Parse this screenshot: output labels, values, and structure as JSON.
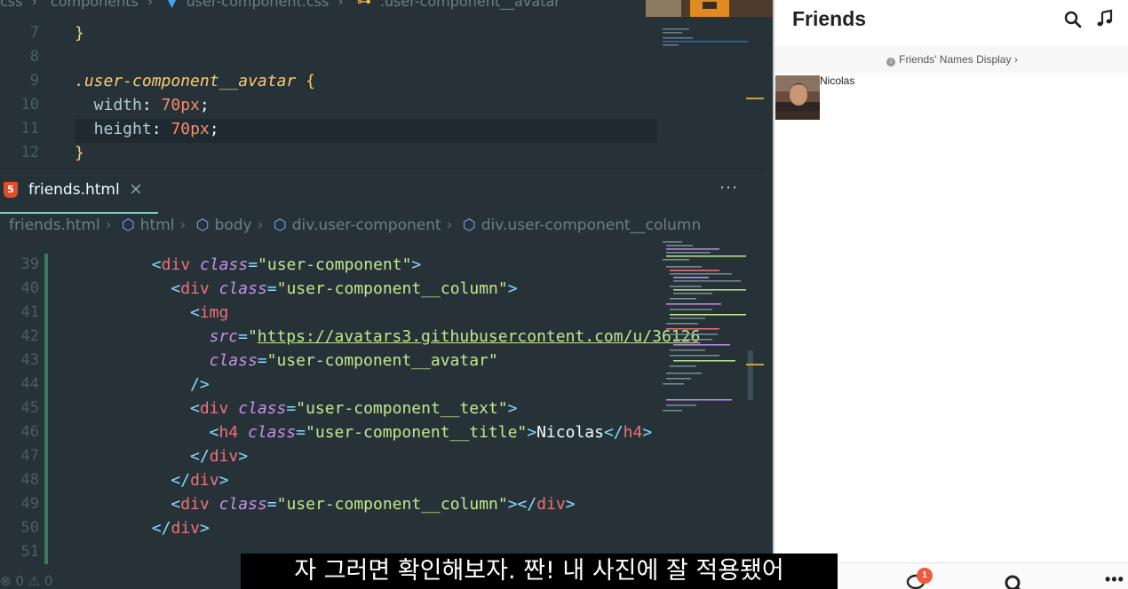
{
  "editor": {
    "top_breadcrumb": [
      "css",
      "components",
      "user-component.css",
      ".user-component__avatar"
    ],
    "css_lines": [
      {
        "num": "7",
        "parts": [
          {
            "c": "t-brace",
            "t": "}"
          }
        ]
      },
      {
        "num": "8",
        "parts": []
      },
      {
        "num": "9",
        "parts": [
          {
            "c": "t-sel",
            "t": ".user-component__avatar"
          },
          {
            "c": "t-plain",
            "t": " "
          },
          {
            "c": "t-brace",
            "t": "{"
          }
        ]
      },
      {
        "num": "10",
        "parts": [
          {
            "c": "t-prop",
            "t": "  width"
          },
          {
            "c": "t-plain",
            "t": ": "
          },
          {
            "c": "t-num",
            "t": "70px"
          },
          {
            "c": "t-plain",
            "t": ";"
          }
        ]
      },
      {
        "num": "11",
        "parts": [
          {
            "c": "t-prop",
            "t": "  height"
          },
          {
            "c": "t-plain",
            "t": ": "
          },
          {
            "c": "t-num",
            "t": "70px"
          },
          {
            "c": "t-plain",
            "t": ";"
          }
        ]
      },
      {
        "num": "12",
        "parts": [
          {
            "c": "t-brace",
            "t": "}"
          }
        ]
      }
    ],
    "tab": {
      "title": "friends.html",
      "close": "×",
      "more": "···",
      "icon_text": "5"
    },
    "breadcrumb": [
      "friends.html",
      "html",
      "body",
      "div.user-component",
      "div.user-component__column"
    ],
    "html_lines": [
      {
        "num": "39",
        "indent": 6,
        "parts": [
          {
            "c": "t-punc",
            "t": "<"
          },
          {
            "c": "t-tag",
            "t": "div"
          },
          {
            "c": "t-plain",
            "t": " "
          },
          {
            "c": "t-attr",
            "t": "class"
          },
          {
            "c": "t-punc",
            "t": "="
          },
          {
            "c": "t-str",
            "t": "\"user-component\""
          },
          {
            "c": "t-punc",
            "t": ">"
          }
        ]
      },
      {
        "num": "40",
        "indent": 8,
        "parts": [
          {
            "c": "t-punc",
            "t": "<"
          },
          {
            "c": "t-tag",
            "t": "div"
          },
          {
            "c": "t-plain",
            "t": " "
          },
          {
            "c": "t-attr",
            "t": "class"
          },
          {
            "c": "t-punc",
            "t": "="
          },
          {
            "c": "t-str",
            "t": "\"user-component__column\""
          },
          {
            "c": "t-punc",
            "t": ">"
          }
        ]
      },
      {
        "num": "41",
        "indent": 10,
        "parts": [
          {
            "c": "t-punc",
            "t": "<"
          },
          {
            "c": "t-tag",
            "t": "img"
          }
        ]
      },
      {
        "num": "42",
        "indent": 12,
        "parts": [
          {
            "c": "t-attr",
            "t": "src"
          },
          {
            "c": "t-punc",
            "t": "="
          },
          {
            "c": "t-str",
            "t": "\""
          },
          {
            "c": "t-link",
            "t": "https://avatars3.githubusercontent.com/u/36126"
          }
        ]
      },
      {
        "num": "43",
        "indent": 12,
        "parts": [
          {
            "c": "t-attr",
            "t": "class"
          },
          {
            "c": "t-punc",
            "t": "="
          },
          {
            "c": "t-str",
            "t": "\"user-component__avatar\""
          }
        ]
      },
      {
        "num": "44",
        "indent": 10,
        "parts": [
          {
            "c": "t-punc",
            "t": "/>"
          }
        ]
      },
      {
        "num": "45",
        "indent": 10,
        "parts": [
          {
            "c": "t-punc",
            "t": "<"
          },
          {
            "c": "t-tag",
            "t": "div"
          },
          {
            "c": "t-plain",
            "t": " "
          },
          {
            "c": "t-attr",
            "t": "class"
          },
          {
            "c": "t-punc",
            "t": "="
          },
          {
            "c": "t-str",
            "t": "\"user-component__text\""
          },
          {
            "c": "t-punc",
            "t": ">"
          }
        ]
      },
      {
        "num": "46",
        "indent": 12,
        "parts": [
          {
            "c": "t-punc",
            "t": "<"
          },
          {
            "c": "t-tag",
            "t": "h4"
          },
          {
            "c": "t-plain",
            "t": " "
          },
          {
            "c": "t-attr",
            "t": "class"
          },
          {
            "c": "t-punc",
            "t": "="
          },
          {
            "c": "t-str",
            "t": "\"user-component__title\""
          },
          {
            "c": "t-punc",
            "t": ">"
          },
          {
            "c": "t-plain",
            "t": "Nicolas"
          },
          {
            "c": "t-punc",
            "t": "</"
          },
          {
            "c": "t-tag",
            "t": "h4"
          },
          {
            "c": "t-punc",
            "t": ">"
          }
        ]
      },
      {
        "num": "47",
        "indent": 10,
        "parts": [
          {
            "c": "t-punc",
            "t": "</"
          },
          {
            "c": "t-tag",
            "t": "div"
          },
          {
            "c": "t-punc",
            "t": ">"
          }
        ]
      },
      {
        "num": "48",
        "indent": 8,
        "parts": [
          {
            "c": "t-punc",
            "t": "</"
          },
          {
            "c": "t-tag",
            "t": "div"
          },
          {
            "c": "t-punc",
            "t": ">"
          }
        ]
      },
      {
        "num": "49",
        "indent": 8,
        "parts": [
          {
            "c": "t-punc",
            "t": "<"
          },
          {
            "c": "t-tag",
            "t": "div"
          },
          {
            "c": "t-plain",
            "t": " "
          },
          {
            "c": "t-attr",
            "t": "class"
          },
          {
            "c": "t-punc",
            "t": "="
          },
          {
            "c": "t-str",
            "t": "\"user-component__column\""
          },
          {
            "c": "t-punc",
            "t": "></"
          },
          {
            "c": "t-tag",
            "t": "div"
          },
          {
            "c": "t-punc",
            "t": ">"
          }
        ]
      },
      {
        "num": "50",
        "indent": 6,
        "parts": [
          {
            "c": "t-punc",
            "t": "</"
          },
          {
            "c": "t-tag",
            "t": "div"
          },
          {
            "c": "t-punc",
            "t": ">"
          }
        ]
      },
      {
        "num": "51",
        "indent": 6,
        "parts": []
      }
    ],
    "status_left": "⊗ 0 ⚠ 0"
  },
  "app": {
    "title": "Friends",
    "section_label": "Friends' Names Display",
    "section_chevron": "›",
    "info_glyph": "i",
    "user": {
      "name": "Nicolas"
    },
    "nav": {
      "badge": "1",
      "more": "•••"
    },
    "colors": {
      "badge": "#ef5a3c",
      "title": "#222222"
    }
  },
  "subtitle": "자 그러면 확인해보자. 짠! 내 사진에 잘 적용됐어"
}
